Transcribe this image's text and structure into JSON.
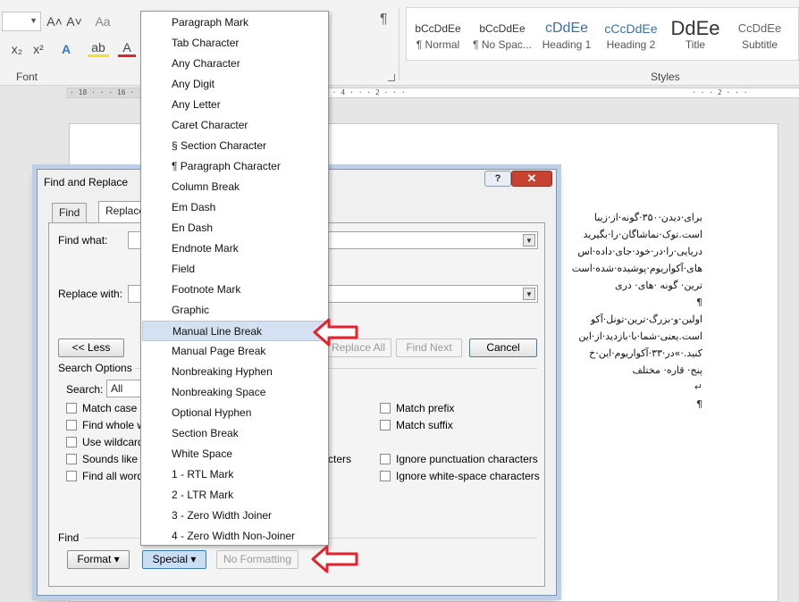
{
  "ribbon": {
    "font_group_label": "Font",
    "styles_group_label": "Styles",
    "styles": [
      {
        "preview": "bCcDdEe",
        "name": "¶ Normal"
      },
      {
        "preview": "bCcDdEe",
        "name": "¶ No Spac..."
      },
      {
        "preview": "cDdEe",
        "name": "Heading 1"
      },
      {
        "preview": "cCcDdEe",
        "name": "Heading 2"
      },
      {
        "preview": "DdEe",
        "name": "Title"
      },
      {
        "preview": "CcDdEe",
        "name": "Subtitle"
      }
    ],
    "buttons": {
      "grow_font": "A˄",
      "shrink_font": "A˅",
      "change_case": "Aa",
      "subscript": "x₂",
      "superscript": "x²",
      "text_effects": "A",
      "highlight": "ab",
      "font_color": "A",
      "pilcrow": "¶"
    }
  },
  "ruler": {
    "left": "· 18 · · · 16 · · · 14 · · · 12 · · · 10 · · · 8 · · · 6 · · · 4 · · · 2 · · ·",
    "right": "· · · 2 · · ·"
  },
  "document": {
    "lines": [
      "برای·دیدن·۳۵۰·گونه·از·زیبا",
      "است.توک·نماشاگان·را·بگیرید",
      "دریایی·را·در·خود·جای·داده·اس",
      "های·آکواریوم·پوشیده·شده·است",
      "ترین· گونه ·های· دری",
      "¶",
      "اولین·و·بزرگ·ترین·تونل·آکو",
      "است.یعنی·شما·با·بازدید·از·این",
      "کنید.·»در·۳۳·آکواریوم·این·خ",
      "پنج· قاره· مختلف",
      "↵",
      "¶"
    ]
  },
  "dialog": {
    "title": "Find and Replace",
    "help_label": "?",
    "close_label": "✕",
    "tabs": {
      "find": "Find",
      "replace": "Replace"
    },
    "find_what_label": "Find what:",
    "find_what_value": "",
    "replace_with_label": "Replace with:",
    "replace_with_value": "",
    "less_button": "<< Less",
    "replace_all_button": "Replace All",
    "find_next_button": "Find Next",
    "cancel_button": "Cancel",
    "search_options_label": "Search Options",
    "search_label": "Search:",
    "search_value": "All",
    "options_left": [
      "Match case",
      "Find whole w",
      "Use wildcard",
      "Sounds like (",
      "Find all word"
    ],
    "options_right": [
      "Match prefix",
      "Match suffix",
      "Ignore punctuation characters",
      "Ignore white-space characters"
    ],
    "options_left_tail": "cters",
    "find_section_label": "Find",
    "format_button": "Format ▾",
    "special_button": "Special ▾",
    "no_formatting_button": "No Formatting"
  },
  "special_menu": {
    "items": [
      "Paragraph Mark",
      "Tab Character",
      "Any Character",
      "Any Digit",
      "Any Letter",
      "Caret Character",
      "§ Section Character",
      "¶ Paragraph Character",
      "Column Break",
      "Em Dash",
      "En Dash",
      "Endnote Mark",
      "Field",
      "Footnote Mark",
      "Graphic",
      "Manual Line Break",
      "Manual Page Break",
      "Nonbreaking Hyphen",
      "Nonbreaking Space",
      "Optional Hyphen",
      "Section Break",
      "White Space",
      "1 - RTL Mark",
      "2 - LTR Mark",
      "3 - Zero Width Joiner",
      "4 - Zero Width Non-Joiner"
    ],
    "highlighted": "Manual Line Break"
  },
  "colors": {
    "highlight": "#d3e1f3",
    "arrow": "#e8202a",
    "close": "#c7422f"
  }
}
